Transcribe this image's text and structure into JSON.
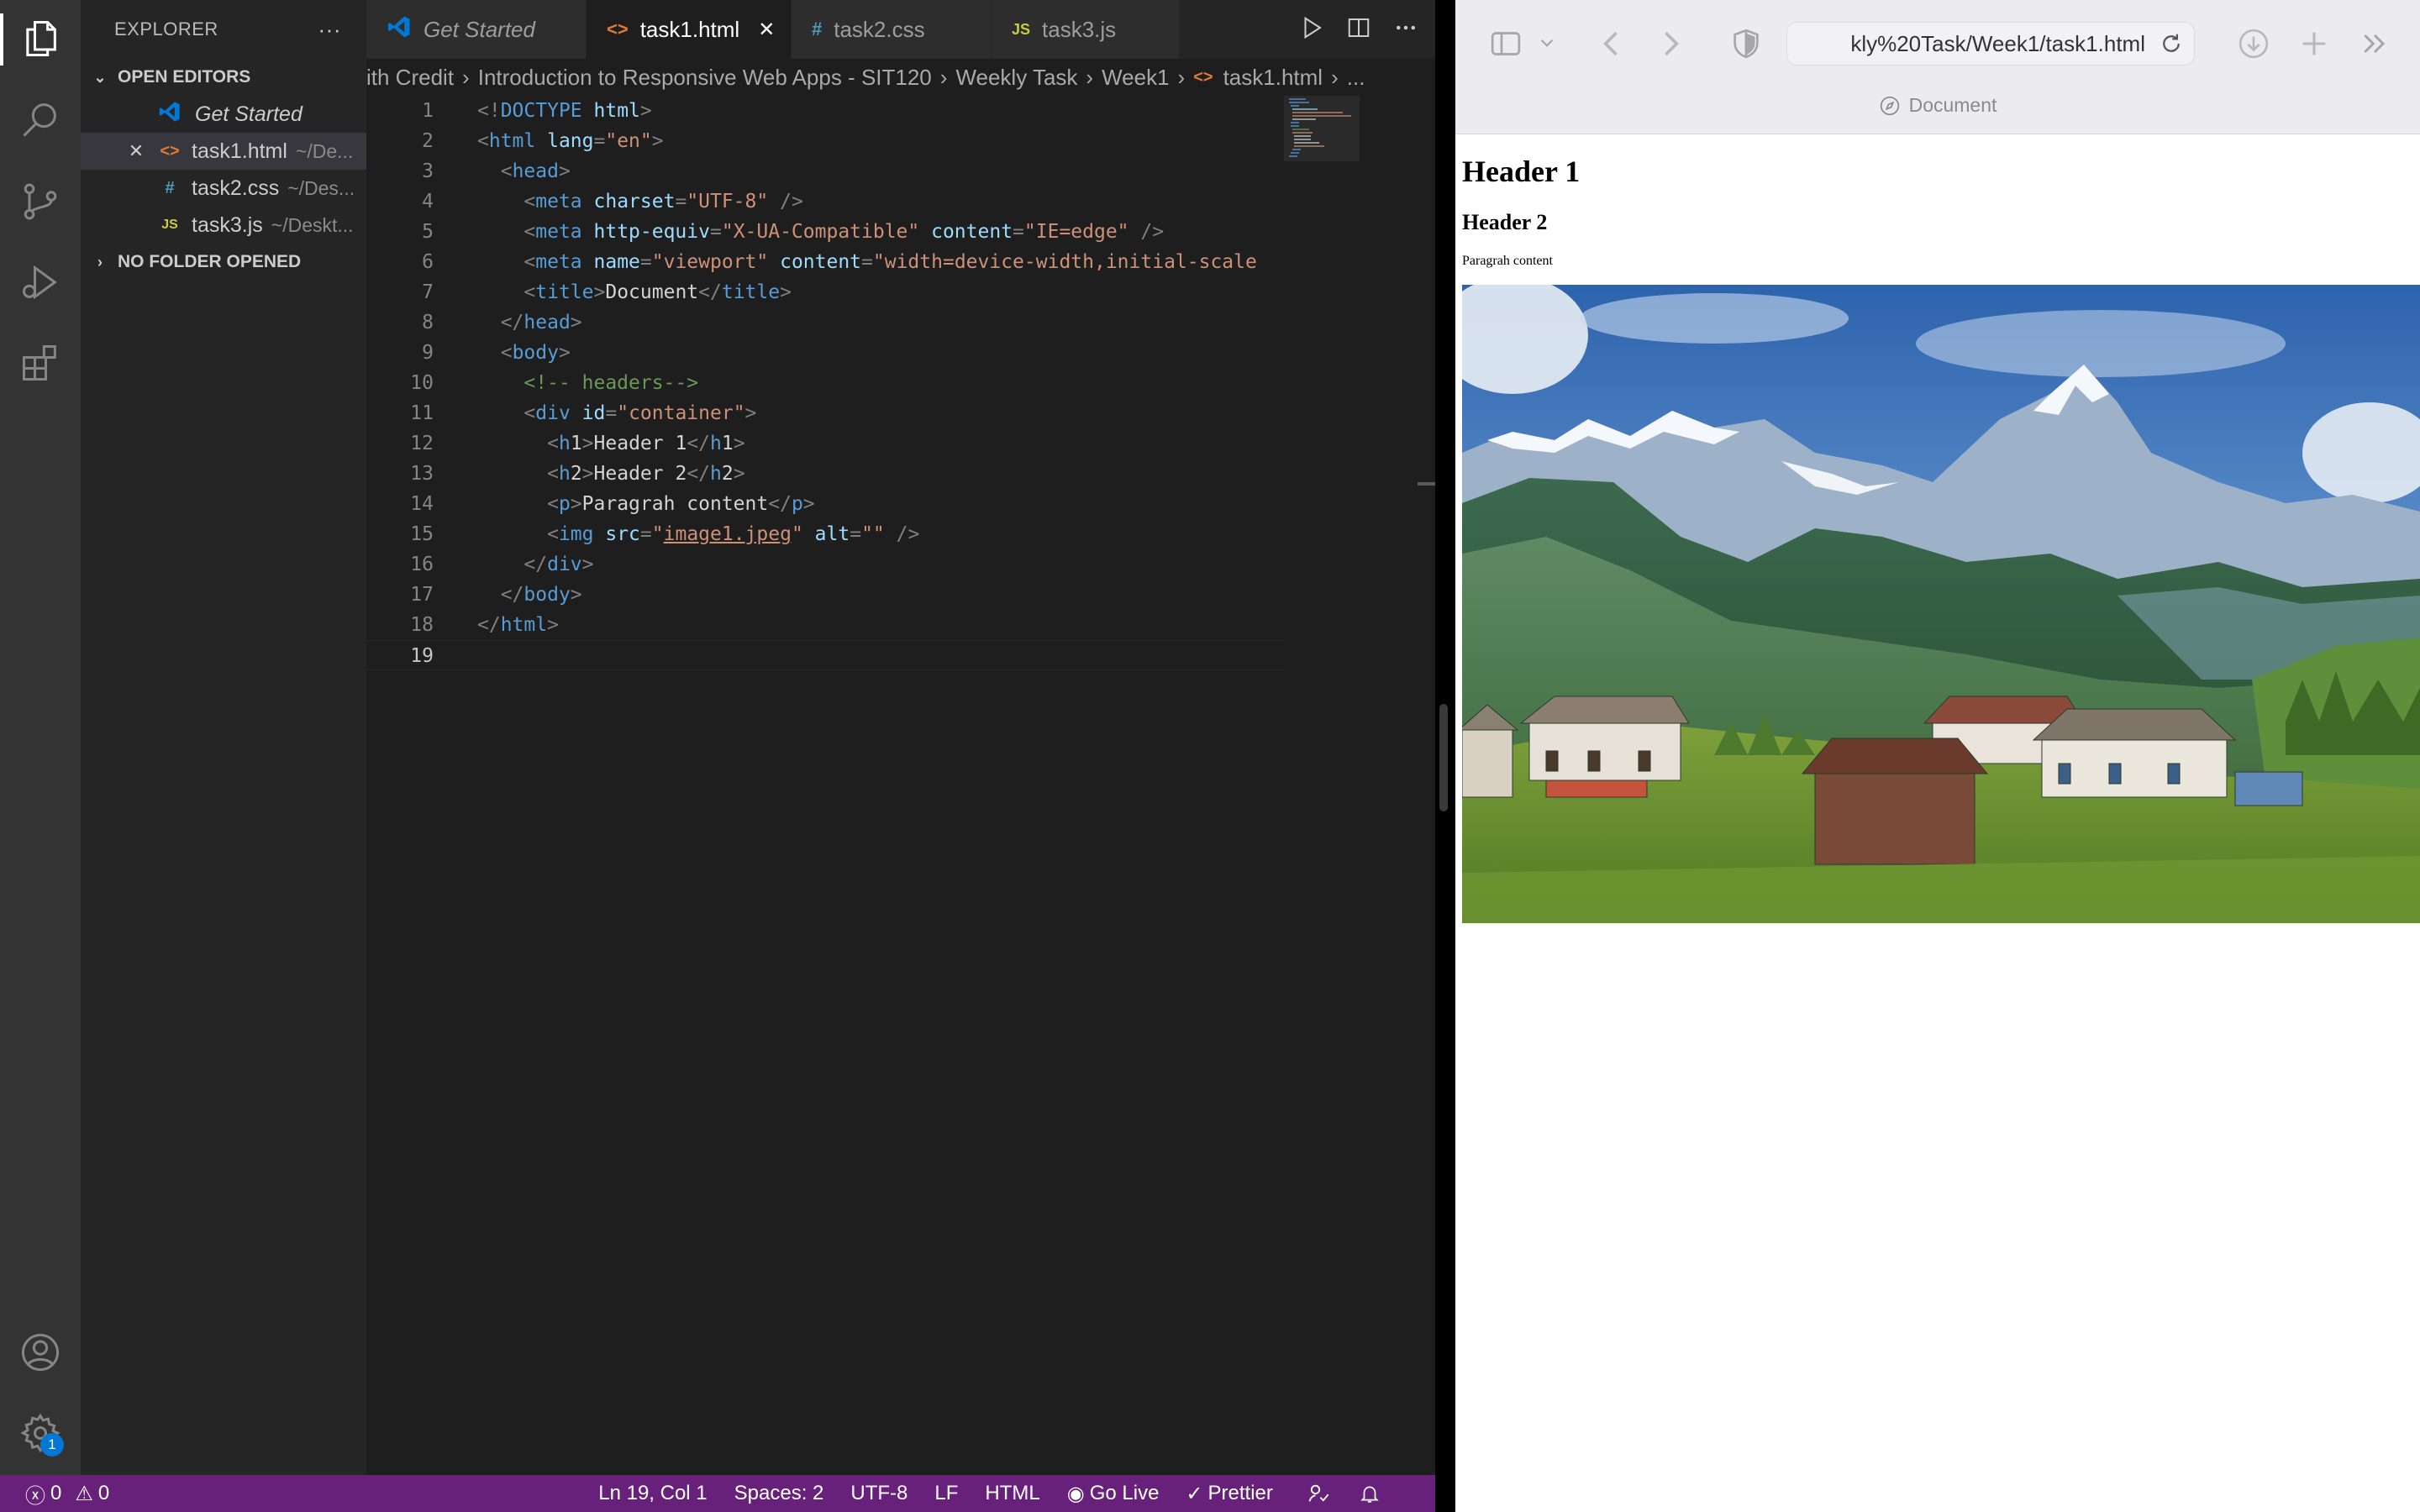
{
  "sidebar": {
    "title": "EXPLORER",
    "more": "···",
    "open_editors_title": "OPEN EDITORS",
    "no_folder_title": "NO FOLDER OPENED",
    "open_editors": [
      {
        "name": "Get Started",
        "path": "",
        "icon": "vscode-logo-icon"
      },
      {
        "name": "task1.html",
        "path": "~/De...",
        "icon": "html-icon"
      },
      {
        "name": "task2.css",
        "path": "~/Des...",
        "icon": "css-icon"
      },
      {
        "name": "task3.js",
        "path": "~/Deskt...",
        "icon": "js-icon"
      }
    ]
  },
  "tabs": [
    {
      "label": "Get Started",
      "icon": "vscode-logo-icon"
    },
    {
      "label": "task1.html",
      "icon": "html-icon"
    },
    {
      "label": "task2.css",
      "icon": "css-icon"
    },
    {
      "label": "task3.js",
      "icon": "js-icon"
    }
  ],
  "icon_glyphs": {
    "html": "<>",
    "css": "#",
    "js": "JS",
    "close": "✕"
  },
  "breadcrumb": [
    "ith Credit",
    "Introduction to Responsive Web Apps - SIT120",
    "Weekly Task",
    "Week1",
    "task1.html",
    "..."
  ],
  "code": {
    "current_line": 19,
    "lines": [
      "<!DOCTYPE html>",
      "<html lang=\"en\">",
      "  <head>",
      "    <meta charset=\"UTF-8\" />",
      "    <meta http-equiv=\"X-UA-Compatible\" content=\"IE=edge\" />",
      "    <meta name=\"viewport\" content=\"width=device-width,initial-scale",
      "    <title>Document</title>",
      "  </head>",
      "  <body>",
      "    <!-- headers-->",
      "    <div id=\"container\">",
      "      <h1>Header 1</h1>",
      "      <h2>Header 2</h2>",
      "      <p>Paragrah content</p>",
      "      <img src=\"image1.jpeg\" alt=\"\" />",
      "    </div>",
      "  </body>",
      "</html>",
      ""
    ]
  },
  "statusbar": {
    "errors": "0",
    "warnings": "0",
    "cursor": "Ln 19, Col 1",
    "spaces": "Spaces: 2",
    "encoding": "UTF-8",
    "eol": "LF",
    "language": "HTML",
    "go_live": "Go Live",
    "prettier": "Prettier"
  },
  "activity": {
    "settings_badge": "1"
  },
  "safari": {
    "url": "kly%20Task/Week1/task1.html",
    "tab_title": "Document"
  },
  "page": {
    "h1": "Header 1",
    "h2": "Header 2",
    "p": "Paragrah content",
    "image_alt": "mountain-village-landscape"
  },
  "colors": {
    "statusbar": "#68217a",
    "editor_bg": "#1e1e1e",
    "sidebar_bg": "#252526",
    "activity_bg": "#333333",
    "html_icon": "#e37933",
    "css_icon": "#519aba",
    "js_icon": "#cbcb41",
    "vscode_blue": "#0078d4"
  }
}
